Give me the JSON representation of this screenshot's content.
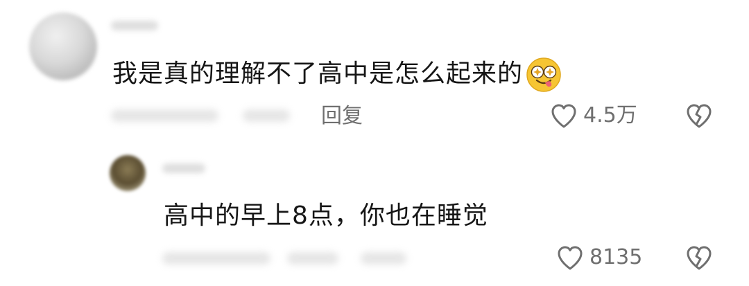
{
  "comments": [
    {
      "text": "我是真的理解不了高中是怎么起来的",
      "emoji": "drooling-face-emoji",
      "reply_label": "回复",
      "like_count": "4.5万"
    },
    {
      "text": "高中的早上8点，你也在睡觉",
      "like_count": "8135"
    }
  ],
  "icons": {
    "like": "heart-outline-icon",
    "dislike": "broken-heart-icon"
  }
}
